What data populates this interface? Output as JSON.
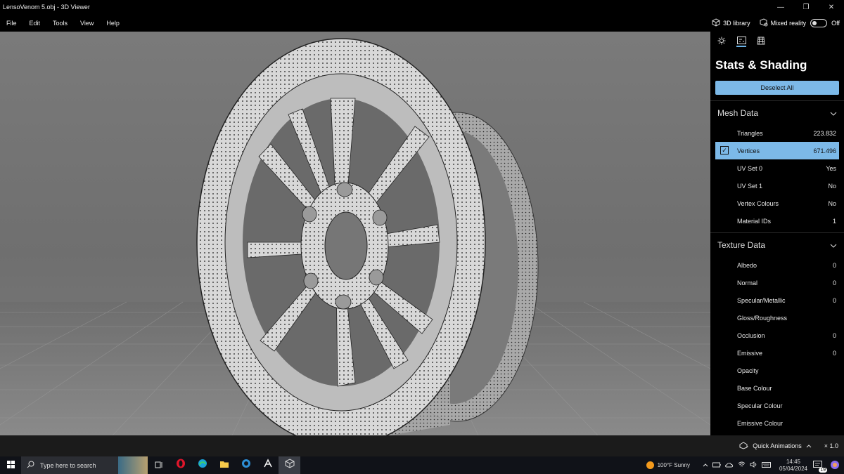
{
  "window": {
    "title": "LensoVenom 5.obj - 3D Viewer",
    "controls": {
      "minimize": "—",
      "maximize": "❐",
      "close": "✕"
    }
  },
  "menu": {
    "items": [
      "File",
      "Edit",
      "Tools",
      "View",
      "Help"
    ],
    "library_label": "3D library",
    "mixed_reality_label": "Mixed reality",
    "toggle_state": "Off"
  },
  "panel": {
    "tab_icons": [
      "lighting-icon",
      "stats-icon",
      "grid-icon"
    ],
    "title": "Stats & Shading",
    "deselect_label": "Deselect All",
    "mesh_section": "Mesh Data",
    "mesh_rows": [
      {
        "label": "Triangles",
        "value": "223.832"
      },
      {
        "label": "Vertices",
        "value": "671.496",
        "selected": true
      },
      {
        "label": "UV Set 0",
        "value": "Yes"
      },
      {
        "label": "UV Set 1",
        "value": "No"
      },
      {
        "label": "Vertex Colours",
        "value": "No"
      },
      {
        "label": "Material IDs",
        "value": "1"
      }
    ],
    "texture_section": "Texture Data",
    "texture_rows": [
      {
        "label": "Albedo",
        "value": "0"
      },
      {
        "label": "Normal",
        "value": "0"
      },
      {
        "label": "Specular/Metallic",
        "value": "0"
      },
      {
        "label": "Gloss/Roughness",
        "value": ""
      },
      {
        "label": "Occlusion",
        "value": "0"
      },
      {
        "label": "Emissive",
        "value": "0"
      },
      {
        "label": "Opacity",
        "value": ""
      },
      {
        "label": "Base Colour",
        "value": ""
      },
      {
        "label": "Specular Colour",
        "value": ""
      },
      {
        "label": "Emissive Colour",
        "value": ""
      }
    ]
  },
  "status": {
    "quick_animations": "Quick Animations",
    "speed": "× 1.0"
  },
  "taskbar": {
    "search_placeholder": "Type here to search",
    "weather": "100°F  Sunny",
    "time": "14:45",
    "date": "05/04/2024",
    "notification_count": "19"
  },
  "colors": {
    "accent": "#7cb9e8",
    "panel_bg": "#000000",
    "viewport_bg": "#747474"
  }
}
